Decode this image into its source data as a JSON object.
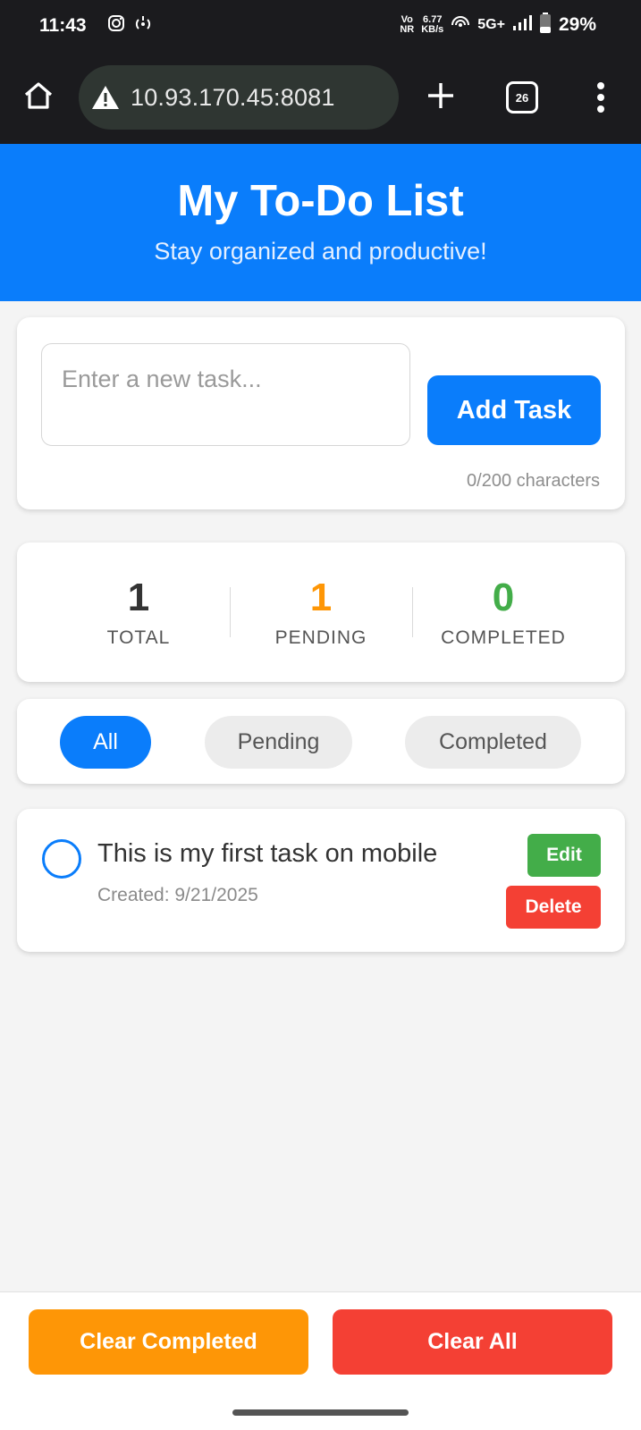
{
  "status_bar": {
    "time": "11:43",
    "network_rate_value": "6.77",
    "network_rate_unit": "KB/s",
    "volte_top": "Vo",
    "volte_bottom": "NR",
    "network_type": "5G+",
    "battery_percent": "29%"
  },
  "browser": {
    "url": "10.93.170.45:8081",
    "tab_count": "26"
  },
  "header": {
    "title": "My To-Do List",
    "subtitle": "Stay organized and productive!"
  },
  "input_section": {
    "placeholder": "Enter a new task...",
    "value": "",
    "add_button_label": "Add Task",
    "char_count": "0/200 characters"
  },
  "stats": {
    "total_value": "1",
    "total_label": "TOTAL",
    "pending_value": "1",
    "pending_label": "PENDING",
    "completed_value": "0",
    "completed_label": "COMPLETED"
  },
  "filters": {
    "all": "All",
    "pending": "Pending",
    "completed": "Completed",
    "active": "All"
  },
  "tasks": [
    {
      "text": "This is my first task on mobile",
      "created": "Created: 9/21/2025",
      "completed": false,
      "edit_label": "Edit",
      "delete_label": "Delete"
    }
  ],
  "footer": {
    "clear_completed_label": "Clear Completed",
    "clear_all_label": "Clear All"
  },
  "colors": {
    "primary": "#0a7dfb",
    "pending": "#fe9606",
    "completed": "#43ad49",
    "danger": "#f44034",
    "total": "#333333"
  },
  "icons": {
    "home": "home-icon",
    "warning": "warning-icon",
    "new_tab": "plus-icon",
    "tabs": "tabs-icon",
    "menu": "more-vert-icon",
    "instagram": "instagram-icon",
    "hotspot": "hotspot-icon",
    "wifi": "wifi-icon",
    "signal": "signal-icon",
    "battery": "battery-icon"
  }
}
